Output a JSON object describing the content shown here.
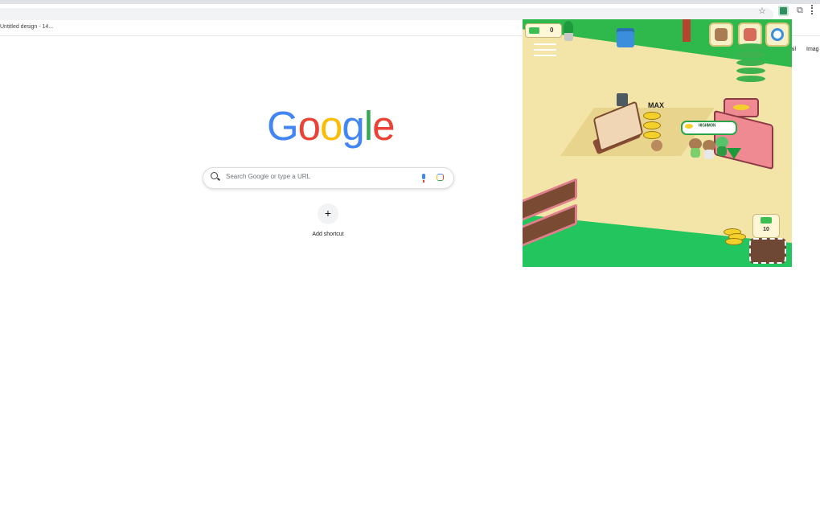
{
  "browser": {
    "bookmark": "Untitled design - 14...",
    "right_links": [
      "ail",
      "Imag"
    ]
  },
  "new_tab": {
    "logo": [
      "G",
      "o",
      "o",
      "g",
      "l",
      "e"
    ],
    "logo_colors": [
      "#4285f4",
      "#ea4335",
      "#fbbc04",
      "#4285f4",
      "#34a853",
      "#ea4335"
    ],
    "search_placeholder": "Search Google or type a URL",
    "shortcut_plus": "+",
    "shortcut_label": "Add shortcut"
  },
  "game": {
    "cash": "0",
    "name_label": "MAX",
    "speech": "ᴴᴵᴳᴴᴹᴼᴺ",
    "price": "10"
  },
  "icons": [
    "star-icon",
    "extension-icon",
    "puzzle-icon",
    "menu-dots-icon",
    "search-icon",
    "mic-icon",
    "lens-icon",
    "hamburger-icon",
    "trash-icon",
    "gear-icon",
    "cash-icon"
  ],
  "colors": {
    "hedge": "#2fb94c",
    "ground": "#f3e5a8",
    "stall": "#ef8a92"
  }
}
